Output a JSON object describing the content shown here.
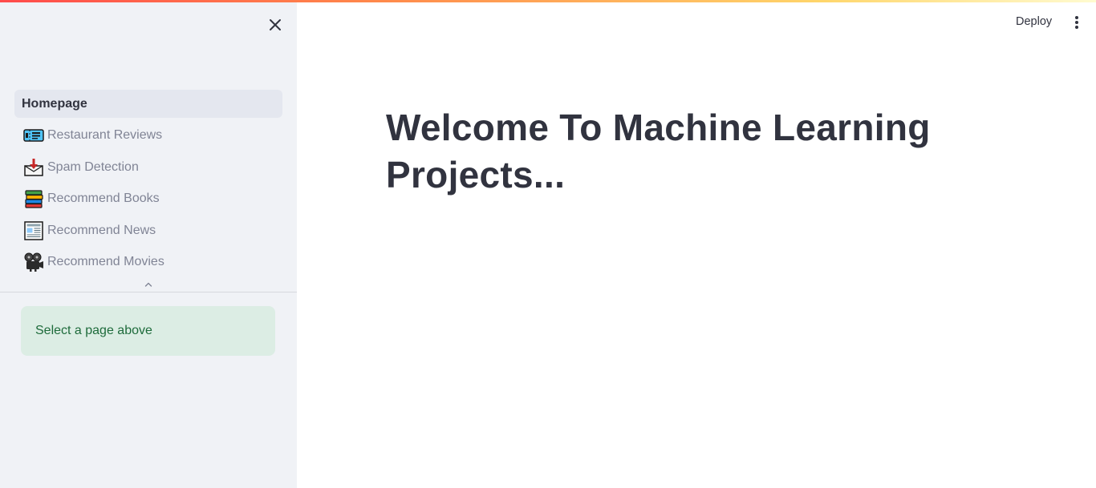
{
  "header": {
    "deploy_label": "Deploy"
  },
  "sidebar": {
    "items": [
      {
        "label": "Homepage",
        "icon": null,
        "active": true
      },
      {
        "label": "Restaurant Reviews",
        "icon": "ticket-icon",
        "active": false
      },
      {
        "label": "Spam Detection",
        "icon": "inbox-tray-icon",
        "active": false
      },
      {
        "label": "Recommend Books",
        "icon": "books-icon",
        "active": false
      },
      {
        "label": "Recommend News",
        "icon": "newspaper-icon",
        "active": false
      },
      {
        "label": "Recommend Movies",
        "icon": "film-projector-icon",
        "active": false
      }
    ],
    "info_message": "Select a page above"
  },
  "main": {
    "title": "Welcome To Machine Learning Projects..."
  },
  "colors": {
    "sidebar_bg": "#f0f2f6",
    "active_item_bg": "#e4e7ef",
    "info_bg": "#dcede4",
    "info_text": "#1e6b3b",
    "accent_gradient_start": "#ff4b4b",
    "accent_gradient_end": "#fffbd0"
  }
}
